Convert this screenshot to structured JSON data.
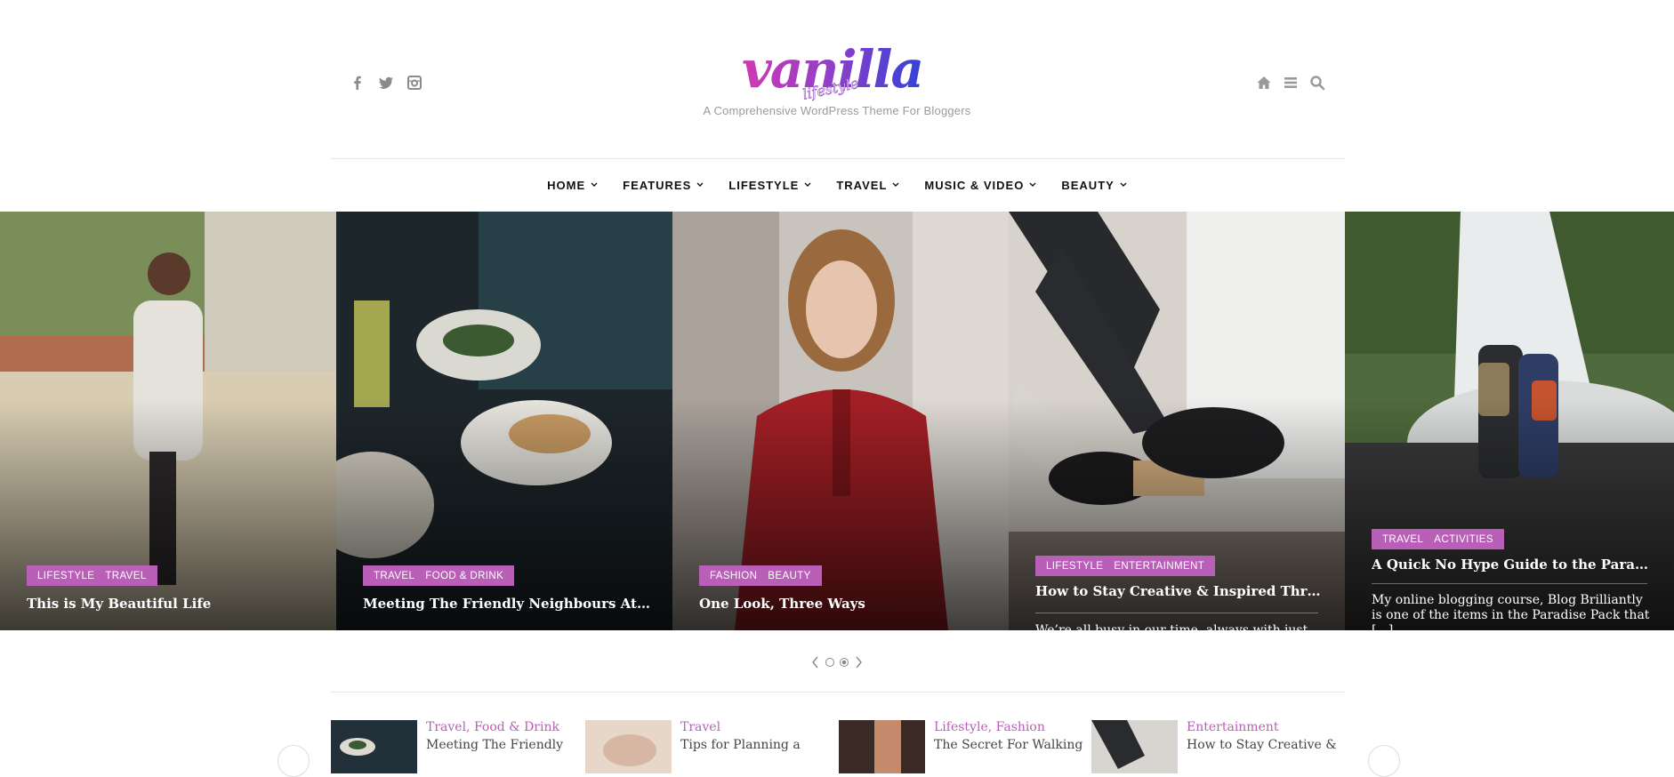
{
  "site": {
    "logo_main": "vanilla",
    "logo_sub": "lifestyle",
    "tagline": "A Comprehensive WordPress Theme For Bloggers"
  },
  "header": {
    "social_icons": [
      "facebook-icon",
      "twitter-icon",
      "instagram-icon"
    ],
    "tool_icons": [
      "home-icon",
      "menu-icon",
      "search-icon"
    ]
  },
  "nav": {
    "items": [
      {
        "label": "HOME"
      },
      {
        "label": "FEATURES"
      },
      {
        "label": "LIFESTYLE"
      },
      {
        "label": "TRAVEL"
      },
      {
        "label": "MUSIC & VIDEO"
      },
      {
        "label": "BEAUTY"
      }
    ]
  },
  "slider": {
    "slides": [
      {
        "cats": [
          "LIFESTYLE",
          "TRAVEL"
        ],
        "title": "This is My Beautiful Life"
      },
      {
        "cats": [
          "TRAVEL",
          "FOOD & DRINK"
        ],
        "title": "Meeting The Friendly Neighbours At Our..."
      },
      {
        "cats": [
          "FASHION",
          "BEAUTY"
        ],
        "title": "One Look, Three Ways"
      },
      {
        "cats": [
          "LIFESTYLE",
          "ENTERTAINMENT"
        ],
        "title": "How to Stay Creative & Inspired Through...",
        "excerpt": "We’re all busy in our time, always with just..."
      },
      {
        "cats": [
          "TRAVEL",
          "ACTIVITIES"
        ],
        "title": "A Quick No Hype Guide to the Paradise Pack",
        "excerpt": "My online blogging course, Blog Brilliantly is one of the items in the Paradise Pack that [...]"
      }
    ]
  },
  "related": {
    "items": [
      {
        "cat": "Travel, Food & Drink",
        "title": "Meeting The Friendly"
      },
      {
        "cat": "Travel",
        "title": "Tips for Planning a"
      },
      {
        "cat": "Lifestyle, Fashion",
        "title": "The Secret For Walking"
      },
      {
        "cat": "Entertainment",
        "title": "How to Stay Creative &"
      }
    ]
  },
  "colors": {
    "accent": "#b95fb8",
    "category_bg": "#b95fb8"
  }
}
